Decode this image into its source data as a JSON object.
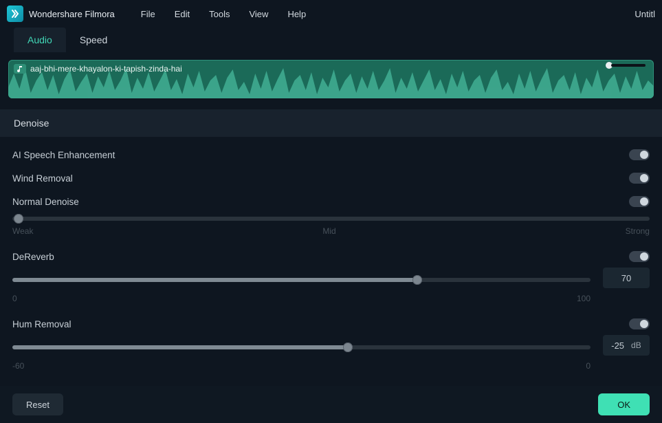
{
  "app": {
    "name": "Wondershare Filmora",
    "doc_title": "Untitl"
  },
  "menu": {
    "items": [
      "File",
      "Edit",
      "Tools",
      "View",
      "Help"
    ]
  },
  "tabs": {
    "items": [
      "Audio",
      "Speed"
    ],
    "active_index": 0
  },
  "clip": {
    "filename": "aaj-bhi-mere-khayalon-ki-tapish-zinda-hai"
  },
  "section": {
    "title": "Denoise"
  },
  "controls": {
    "ai_speech": {
      "label": "AI Speech Enhancement",
      "on": false
    },
    "wind_removal": {
      "label": "Wind Removal",
      "on": false
    },
    "normal_denoise": {
      "label": "Normal Denoise",
      "on": false,
      "scale_left": "Weak",
      "scale_mid": "Mid",
      "scale_right": "Strong",
      "value_pct": 0
    },
    "dereverb": {
      "label": "DeReverb",
      "on": false,
      "scale_left": "0",
      "scale_right": "100",
      "value": "70",
      "value_pct": 70
    },
    "hum_removal": {
      "label": "Hum Removal",
      "on": false,
      "scale_left": "-60",
      "scale_right": "0",
      "value": "-25",
      "unit": "dB",
      "value_pct": 58
    }
  },
  "footer": {
    "reset": "Reset",
    "ok": "OK"
  }
}
